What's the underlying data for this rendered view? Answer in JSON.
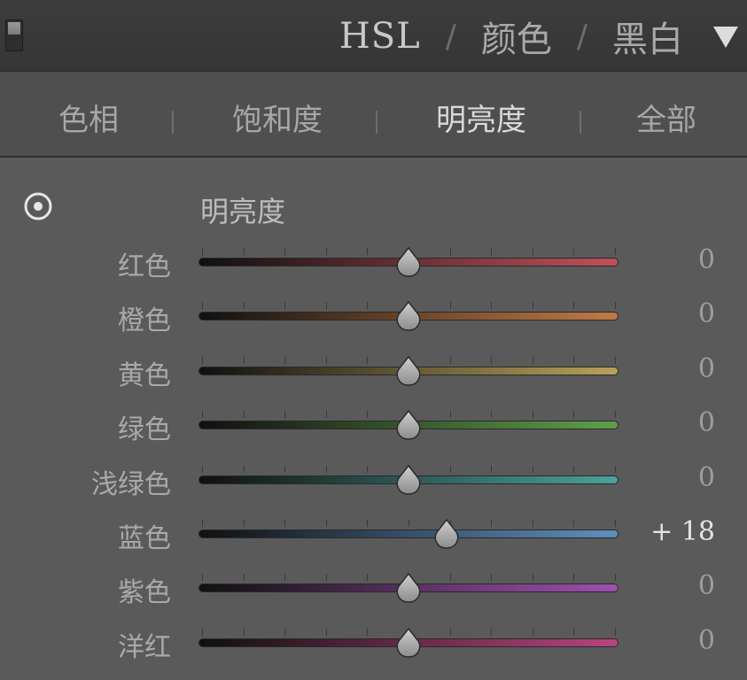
{
  "header": {
    "tabs": [
      {
        "label": "HSL",
        "active": true
      },
      {
        "label": "颜色",
        "active": false
      },
      {
        "label": "黑白",
        "active": false
      }
    ],
    "separator": "/",
    "collapse_icon": "triangle-down-icon"
  },
  "subtabs": [
    {
      "label": "色相",
      "active": false
    },
    {
      "label": "饱和度",
      "active": false
    },
    {
      "label": "明亮度",
      "active": true
    },
    {
      "label": "全部",
      "active": false
    }
  ],
  "section": {
    "title": "明亮度",
    "target_icon": "target-adjust-icon"
  },
  "sliders": [
    {
      "label": "红色",
      "value": 0,
      "display": "0",
      "color": "#c0505a"
    },
    {
      "label": "橙色",
      "value": 0,
      "display": "0",
      "color": "#c27a45"
    },
    {
      "label": "黄色",
      "value": 0,
      "display": "0",
      "color": "#b9a25a"
    },
    {
      "label": "绿色",
      "value": 0,
      "display": "0",
      "color": "#5fa04a"
    },
    {
      "label": "浅绿色",
      "value": 0,
      "display": "0",
      "color": "#4aa39a"
    },
    {
      "label": "蓝色",
      "value": 18,
      "display": "+ 18",
      "color": "#5f8fc0"
    },
    {
      "label": "紫色",
      "value": 0,
      "display": "0",
      "color": "#a050b0"
    },
    {
      "label": "洋红",
      "value": 0,
      "display": "0",
      "color": "#b8447e"
    }
  ],
  "slider_range": [
    -100,
    100
  ]
}
